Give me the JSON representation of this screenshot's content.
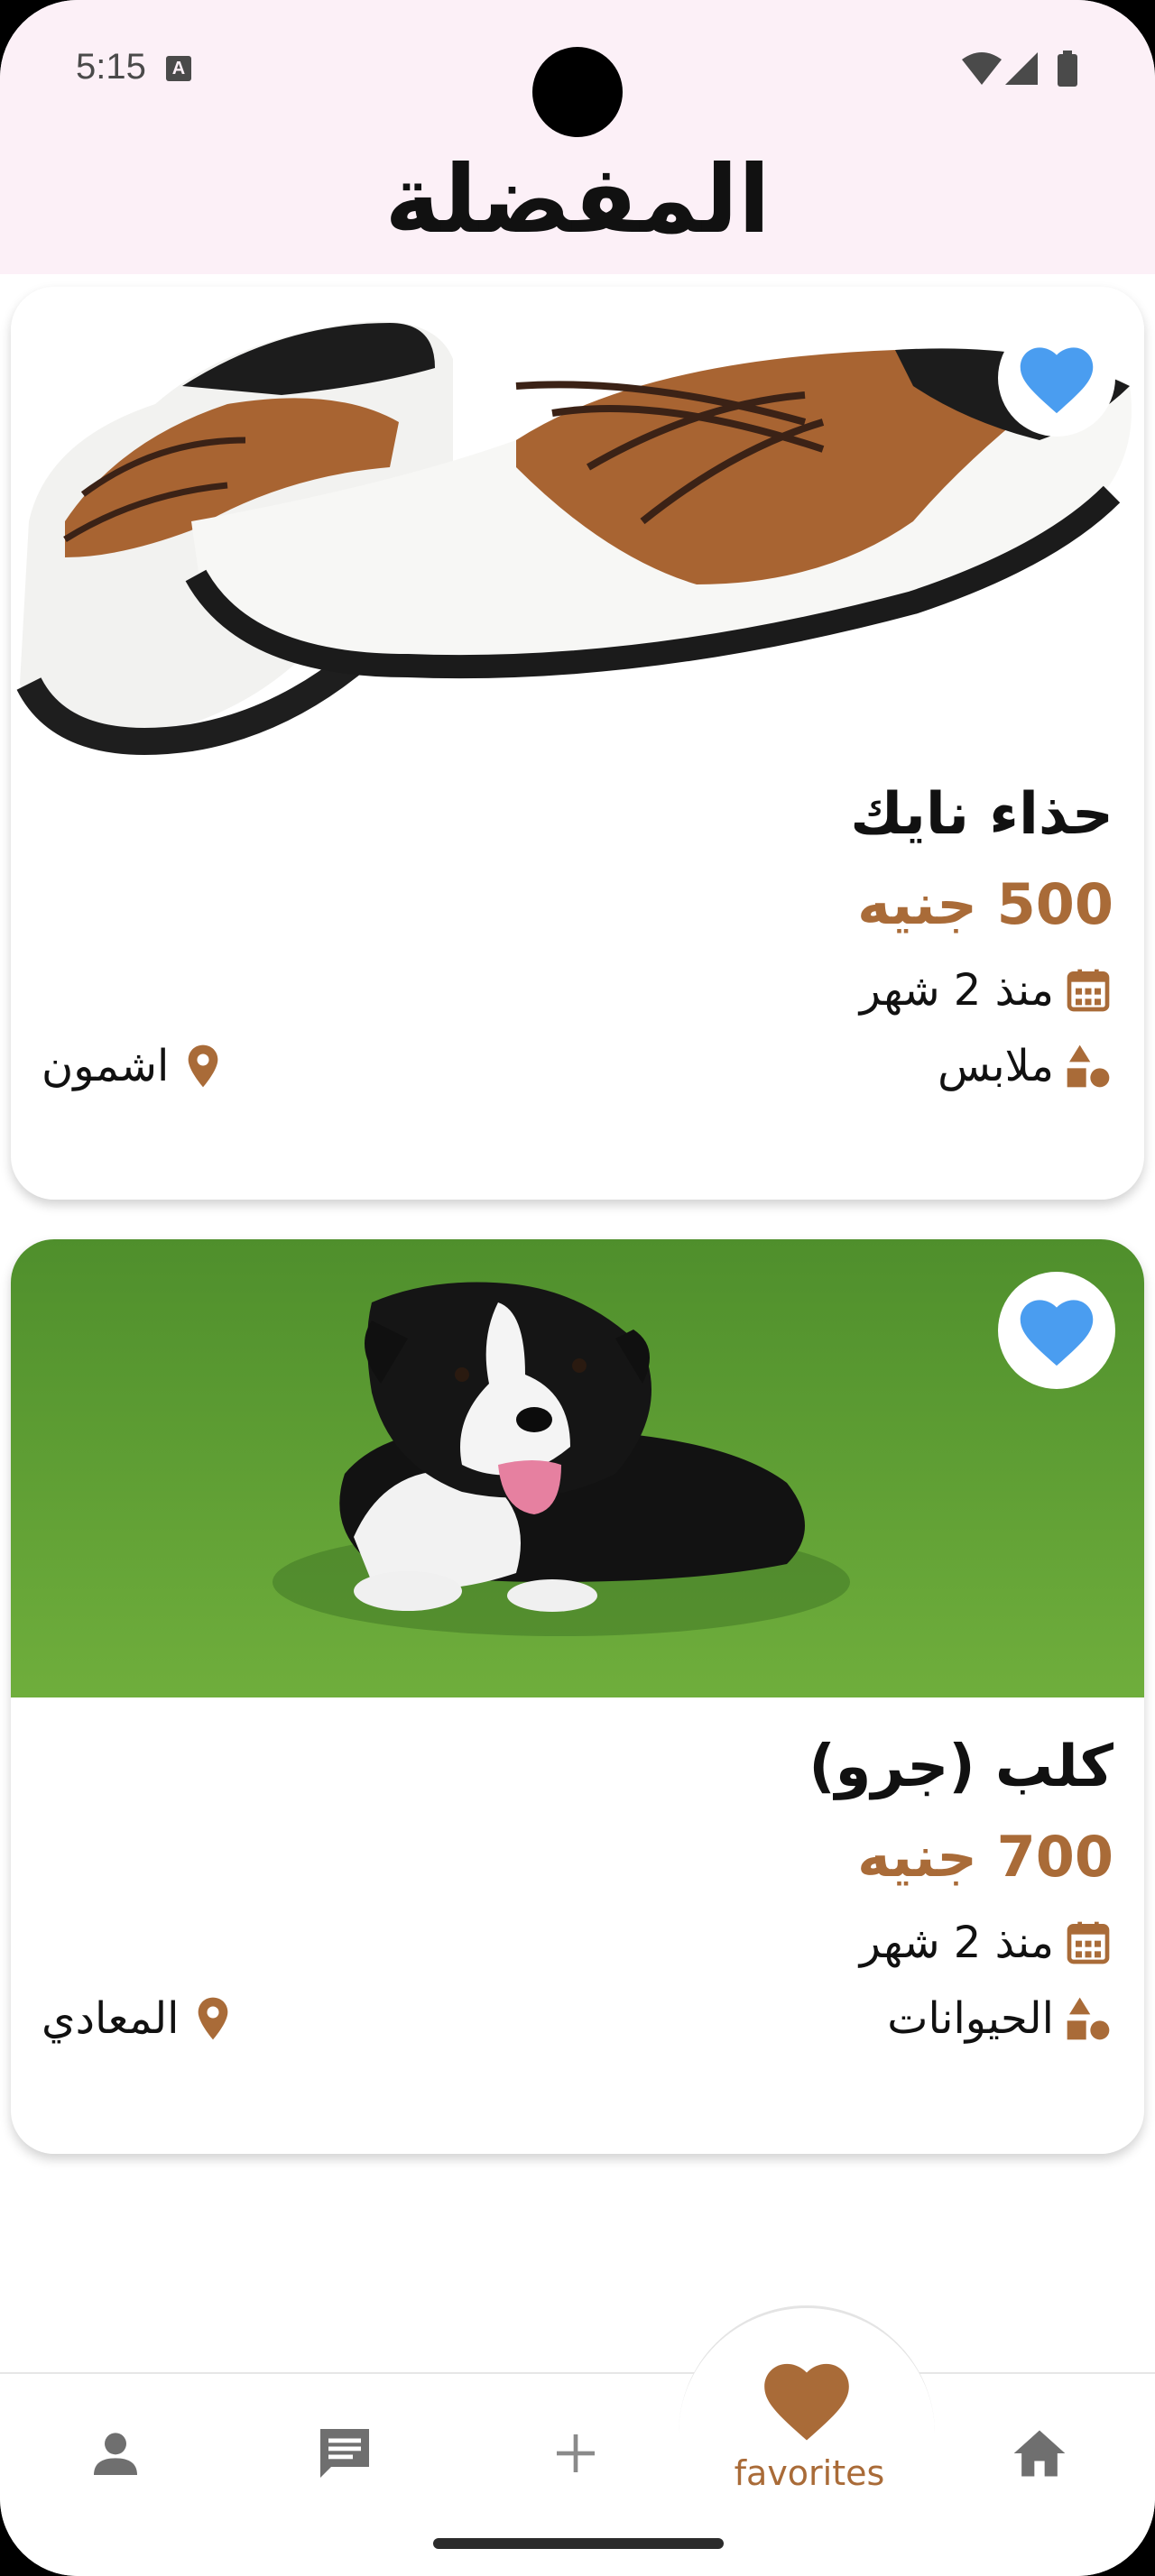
{
  "status_bar": {
    "time": "5:15",
    "badge": "A"
  },
  "header": {
    "title": "المفضلة"
  },
  "items": [
    {
      "title": "حذاء نايك",
      "price": "500 جنيه",
      "date": "منذ 2 شهر",
      "category": "ملابس",
      "location": "اشمون",
      "favorite": true
    },
    {
      "title": "كلب (جرو)",
      "price": "700 جنيه",
      "date": "منذ 2 شهر",
      "category": "الحيوانات",
      "location": "المعادي",
      "favorite": true
    }
  ],
  "bottom_nav": {
    "items": [
      "profile-icon",
      "chat-icon",
      "add-icon",
      "heart-icon",
      "home-icon"
    ],
    "active_label": "favorites"
  },
  "colors": {
    "accent": "#a96b38",
    "heart_blue": "#4a9df0",
    "header_bg": "#fcf0f7"
  }
}
